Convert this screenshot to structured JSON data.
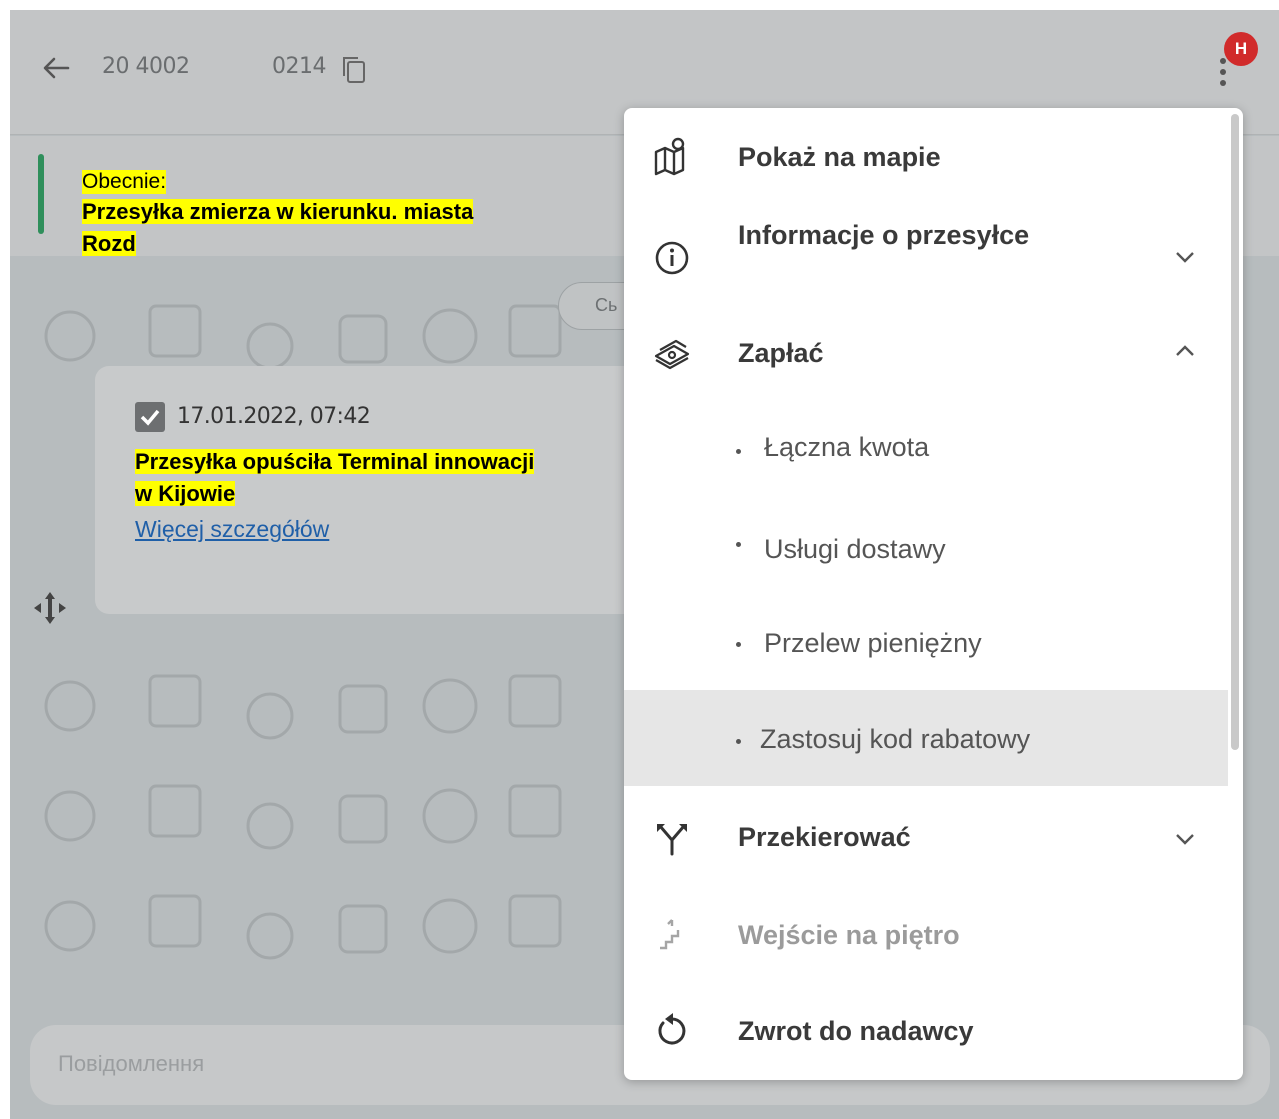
{
  "header": {
    "tracking_part1": "20 4002",
    "tracking_part2": "0214",
    "avatar_letter": "H"
  },
  "status": {
    "label": "Obecnie:",
    "text_line1": "Przesyłka zmierza w kierunku. miasta",
    "text_line2": "Rozd",
    "chip_text": "Сь"
  },
  "event": {
    "datetime": "17.01.2022, 07:42",
    "text_line1": "Przesyłka opuściła Terminal innowacji",
    "text_line2": "w Kijowie",
    "link": "Więcej szczegółów"
  },
  "input": {
    "placeholder": "Повідомлення"
  },
  "menu": {
    "items": [
      {
        "label": "Pokaż na mapie",
        "icon": "map-pin-icon"
      },
      {
        "label": "Informacje o przesyłce",
        "icon": "info-icon",
        "expanded": false
      },
      {
        "label": "Zapłać",
        "icon": "money-icon",
        "expanded": true
      },
      {
        "label": "Przekierować",
        "icon": "redirect-icon",
        "expanded": false
      },
      {
        "label": "Wejście na piętro",
        "icon": "stairs-icon",
        "disabled": true
      },
      {
        "label": "Zwrot do nadawcy",
        "icon": "return-icon"
      }
    ],
    "pay_subitems": [
      {
        "label": "Łączna kwota"
      },
      {
        "label": "Usługi dostawy"
      },
      {
        "label": "Przelew pieniężny"
      },
      {
        "label": "Zastosuj kod rabatowy",
        "highlighted": true
      }
    ]
  },
  "colors": {
    "accent_green": "#2f8f5b",
    "avatar_red": "#d12b2b",
    "highlight_yellow": "#ffff00",
    "link_blue": "#1f5fa8"
  }
}
